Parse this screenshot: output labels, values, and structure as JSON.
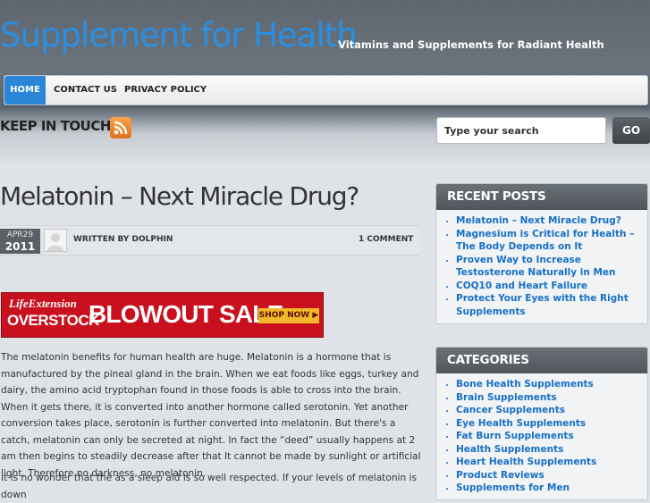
{
  "site": {
    "title": "Supplement for Health",
    "tagline": "Vitamins and Supplements for Radiant Health"
  },
  "nav": {
    "items": [
      {
        "label": "HOME",
        "active": true
      },
      {
        "label": "CONTACT US",
        "active": false
      },
      {
        "label": "PRIVACY POLICY",
        "active": false
      }
    ]
  },
  "keep_in_touch": {
    "title": "KEEP IN TOUCH",
    "icon": "rss-icon"
  },
  "search": {
    "placeholder": "Type your search",
    "button_label": "GO"
  },
  "post": {
    "title": "Melatonin – Next Miracle Drug?",
    "date_month_day": "APR29",
    "date_year": "2011",
    "author": "WRITTEN BY DOLPHIN",
    "comments": "1 COMMENT",
    "banner": {
      "brand_line1": "LifeExtension",
      "brand_line2": "OVERSTOCK",
      "headline": "BLOWOUT SALE",
      "cta": "SHOP NOW ▶"
    },
    "paragraphs": [
      "The melatonin benefits for human health are huge. Melatonin is a hormone that is manufactured by the pineal gland in the brain. When we eat foods like eggs, turkey and dairy, the amino acid tryptophan found in those foods is able to cross into the brain. When it gets there, it is converted into another hormone called serotonin. Yet another conversion takes place, serotonin is further converted into melatonin. But there's a catch, melatonin can only be secreted at night. In fact the “deed” usually happens at 2 am then begins to steadily decrease after that It cannot be made by sunlight or artificial light. Therefore no darkness, no melatonin.",
      "It is no wonder that the as a sleep aid is so well respected. If your levels of melatonin is down"
    ]
  },
  "sidebar": {
    "recent_posts": {
      "title": "RECENT POSTS",
      "items": [
        "Melatonin – Next Miracle Drug?",
        "Magnesium is Critical for Health – The Body Depends on It",
        "Proven Way to Increase Testosterone Naturally in Men",
        "COQ10 and Heart Failure",
        "Protect Your Eyes with the Right Supplements"
      ]
    },
    "categories": {
      "title": "CATEGORIES",
      "items": [
        "Bone Health Supplements",
        "Brain Supplements",
        "Cancer Supplements",
        "Eye Health Supplements",
        "Fat Burn Supplements",
        "Health Supplements",
        "Heart Health Supplements",
        "Product Reviews",
        "Supplements for Men"
      ]
    }
  },
  "colors": {
    "accent_blue": "#2a86d6",
    "link_blue": "#1670c5",
    "banner_red": "#c8101e",
    "header_gray": "#5e6770"
  }
}
